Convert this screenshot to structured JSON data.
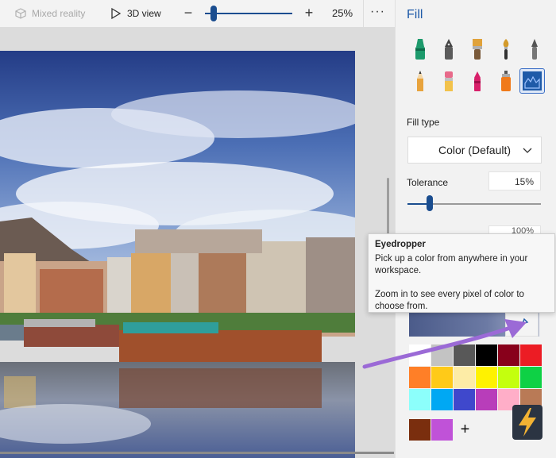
{
  "toolbar": {
    "mixed_reality_label": "Mixed reality",
    "view_3d_label": "3D view",
    "zoom_value": "25%",
    "zoom_minus": "−",
    "zoom_plus": "+",
    "more": "···"
  },
  "panel": {
    "title": "Fill",
    "fill_type_label": "Fill type",
    "fill_type_value": "Color (Default)",
    "tolerance_label": "Tolerance",
    "tolerance_value": "15%",
    "tolerance_fraction": 0.15,
    "opacity_value": "100%",
    "add_color_symbol": "+"
  },
  "tooltip": {
    "title": "Eyedropper",
    "line1": "Pick up a color from anywhere in your workspace.",
    "line2": "Zoom in to see every pixel of color to choose from."
  },
  "icons": {
    "mixed_reality": "mixed-reality-icon",
    "view_3d": "3d-view-icon",
    "eyedropper": "eyedropper-icon",
    "chevron": "chevron-down-icon"
  },
  "colors": {
    "accent": "#1e5aa8",
    "slider": "#1a4d8f",
    "arrow": "#9b6ad6"
  },
  "tools": [
    {
      "name": "marker",
      "color": "#1d9a6c"
    },
    {
      "name": "calligraphy-pen",
      "color": "#5b5b5b"
    },
    {
      "name": "oil-brush",
      "color": "#e0a23a"
    },
    {
      "name": "watercolor",
      "color": "#d39a2a"
    },
    {
      "name": "pixel-pen",
      "color": "#555555"
    },
    {
      "name": "pencil",
      "color": "#e8a33d"
    },
    {
      "name": "eraser",
      "color": "#e86a8a"
    },
    {
      "name": "crayon",
      "color": "#d8206a"
    },
    {
      "name": "spray-can",
      "color": "#f07a1a"
    },
    {
      "name": "fill",
      "color": "#1e5aa8"
    }
  ],
  "palette": [
    "#ffffff",
    "#c3c3c3",
    "#585858",
    "#000000",
    "#88001b",
    "#ec1c24",
    "#ff7f27",
    "#ffca18",
    "#fdeca6",
    "#fff200",
    "#c4ff0e",
    "#0ed145",
    "#8cfffb",
    "#00a8f3",
    "#3f48cc",
    "#b83dba",
    "#ffaec8",
    "#b97a56"
  ],
  "custom_colors": [
    "#7a2e0e",
    "#c052d8"
  ]
}
